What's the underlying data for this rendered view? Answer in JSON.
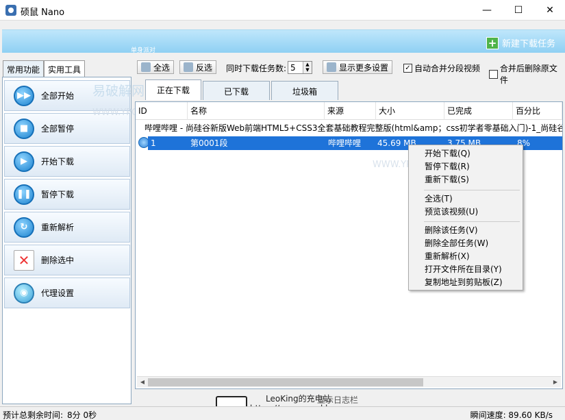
{
  "window": {
    "title": "硕鼠 Nano"
  },
  "banner": {
    "subtitle": "单身派对",
    "new_task_label": "新建下载任务"
  },
  "left_tabs": [
    "常用功能",
    "实用工具"
  ],
  "left_buttons": [
    "全部开始",
    "全部暂停",
    "开始下载",
    "暂停下载",
    "重新解析",
    "删除选中",
    "代理设置"
  ],
  "toolbar": {
    "select_all": "全选",
    "invert": "反选",
    "concurrent_label": "同时下载任务数:",
    "concurrent_value": "5",
    "more_settings": "显示更多设置",
    "auto_merge": "自动合并分段视频",
    "delete_after_merge": "合并后删除原文件"
  },
  "download_tabs": [
    "正在下载",
    "已下载",
    "垃圾箱"
  ],
  "columns": [
    "ID",
    "名称",
    "来源",
    "大小",
    "已完成",
    "百分比"
  ],
  "group_title": "哔哩哔哩 - 尚硅谷新版Web前端HTML5+CSS3全套基础教程完整版(html&amp；css初学者零基础入门)-1_尚硅谷",
  "rows": [
    {
      "id": "1",
      "name": "第0001段",
      "source": "哔哩哔哩",
      "size": "45.69 MB",
      "done": "3.75 MB",
      "percent": "8%"
    }
  ],
  "context_menu": [
    "开始下载(Q)",
    "暂停下载(R)",
    "重新下载(S)",
    "全选(T)",
    "预览该视频(U)",
    "删除该任务(V)",
    "删除全部任务(W)",
    "重新解析(X)",
    "打开文件所在目录(Y)",
    "复制地址到剪贴板(Z)"
  ],
  "status": {
    "remaining_label": "预计总剩余时间:",
    "remaining_value": "8分 0秒",
    "log_label": "显示日志栏",
    "speed_label": "瞬间速度: 89.60 KB/s"
  },
  "watermarks": [
    "易破解网站",
    "WWW.YPOJIE.COM",
    "WWW.YPO",
    "LeoKing的充电站",
    "https://www.cocokl.cn"
  ]
}
